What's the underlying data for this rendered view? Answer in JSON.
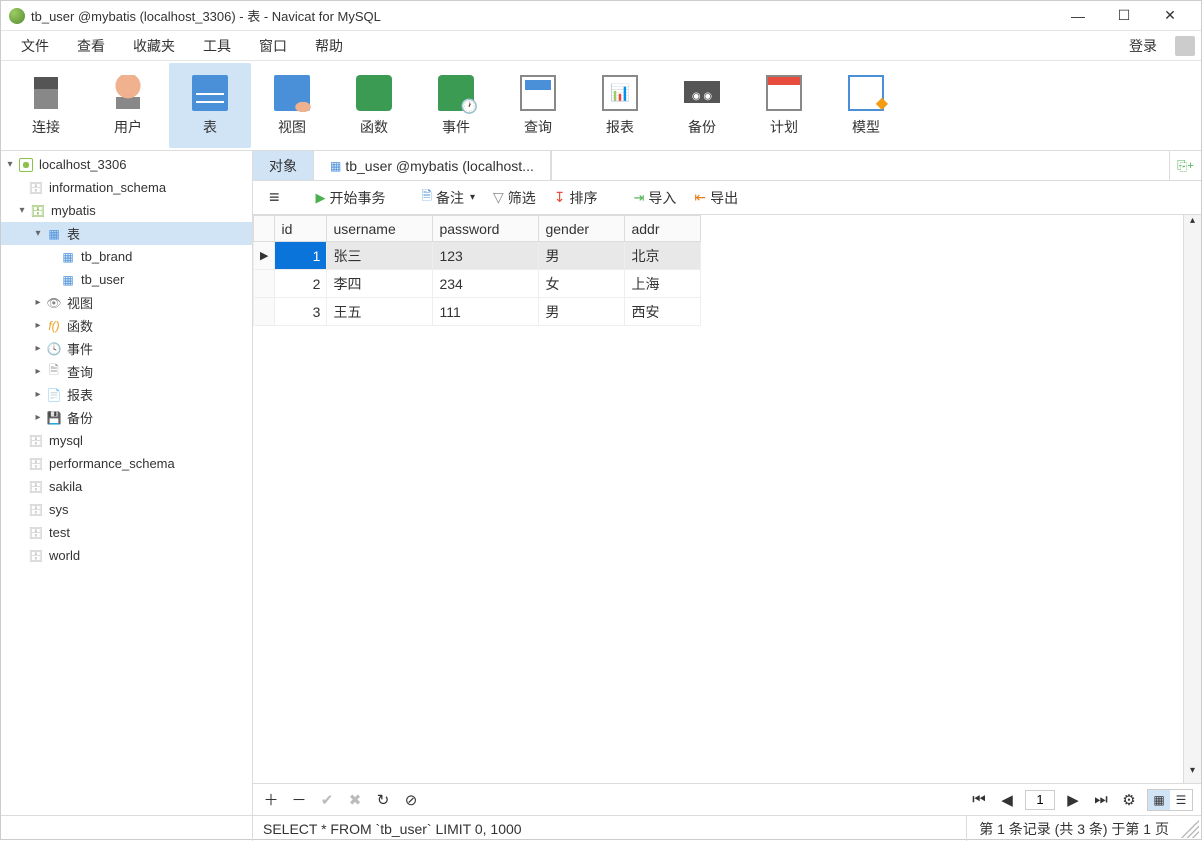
{
  "window": {
    "title": "tb_user @mybatis (localhost_3306) - 表 - Navicat for MySQL"
  },
  "menu": {
    "file": "文件",
    "view": "查看",
    "fav": "收藏夹",
    "tools": "工具",
    "window": "窗口",
    "help": "帮助",
    "login": "登录"
  },
  "toolbar": {
    "connect": "连接",
    "user": "用户",
    "table": "表",
    "view": "视图",
    "function": "函数",
    "event": "事件",
    "query": "查询",
    "report": "报表",
    "backup": "备份",
    "schedule": "计划",
    "model": "模型"
  },
  "tree": {
    "conn": "localhost_3306",
    "dbs": {
      "information_schema": "information_schema",
      "mybatis": "mybatis",
      "mysql": "mysql",
      "performance_schema": "performance_schema",
      "sakila": "sakila",
      "sys": "sys",
      "test": "test",
      "world": "world"
    },
    "mybatis_children": {
      "tables": "表",
      "tb_brand": "tb_brand",
      "tb_user": "tb_user",
      "views": "视图",
      "functions": "函数",
      "events": "事件",
      "queries": "查询",
      "reports": "报表",
      "backups": "备份"
    }
  },
  "tabs": {
    "objects": "对象",
    "table_tab": "tb_user @mybatis (localhost..."
  },
  "actions": {
    "begin_txn": "开始事务",
    "remark": "备注",
    "filter": "筛选",
    "sort": "排序",
    "import": "导入",
    "export": "导出"
  },
  "grid": {
    "columns": {
      "id": "id",
      "username": "username",
      "password": "password",
      "gender": "gender",
      "addr": "addr"
    },
    "rows": [
      {
        "id": "1",
        "username": "张三",
        "password": "123",
        "gender": "男",
        "addr": "北京"
      },
      {
        "id": "2",
        "username": "李四",
        "password": "234",
        "gender": "女",
        "addr": "上海"
      },
      {
        "id": "3",
        "username": "王五",
        "password": "111",
        "gender": "男",
        "addr": "西安"
      }
    ]
  },
  "nav": {
    "page": "1"
  },
  "status": {
    "sql": "SELECT * FROM `tb_user` LIMIT 0, 1000",
    "record": "第 1 条记录 (共 3 条) 于第 1 页"
  }
}
